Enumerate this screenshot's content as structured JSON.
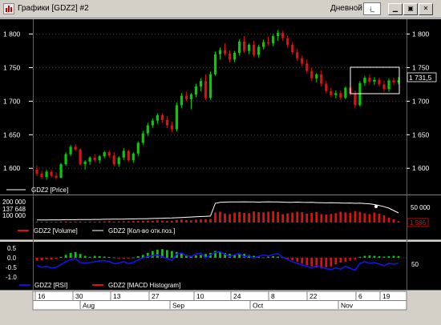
{
  "window": {
    "title": "Графики [GDZ2] #2",
    "period_label": "Дневной",
    "period_icon": "dropdown-arrow-icon",
    "buttons": [
      "minimize-icon",
      "restore-icon",
      "close-icon"
    ]
  },
  "price_pane": {
    "y_labels": [
      "1 800",
      "1 750",
      "1 700",
      "1 650",
      "1 600"
    ],
    "current_price": "1 731,5",
    "legend": [
      {
        "label": "GDZ2 [Price]",
        "color": "#ffffff"
      }
    ]
  },
  "volume_pane": {
    "left_labels": [
      "200 000",
      "137 648",
      "100 000"
    ],
    "right_labels": [
      "50 000"
    ],
    "current_value": "1 586",
    "legend": [
      {
        "label": "GDZ2 [Volume]",
        "color": "#e01010"
      },
      {
        "label": "GDZ2 [Кол-во отк.поз.]",
        "color": "#ffffff"
      }
    ]
  },
  "indicator_pane": {
    "left_labels": [
      "0.5",
      "0.0",
      "-0.5",
      "-1.0"
    ],
    "right_labels": [
      "50"
    ],
    "legend": [
      {
        "label": "GDZ2 [RSI]",
        "color": "#1010e0"
      },
      {
        "label": "GDZ2 [MACD Histogram]",
        "color": "#e01010"
      }
    ]
  },
  "date_axis": {
    "days": [
      "16",
      "30",
      "13",
      "27",
      "10",
      "24",
      "8",
      "22",
      "6",
      "19"
    ],
    "months": [
      "Aug",
      "Sep",
      "Oct",
      "Nov"
    ]
  },
  "colors": {
    "background": "#000000",
    "bull": "#00d000",
    "bear": "#e01010",
    "grid": "#404040",
    "window": "#d4d0c8",
    "highlight_box": "#ffffff"
  },
  "chart_data": [
    {
      "type": "candlestick",
      "title": "",
      "series_name": "GDZ2 [Price]",
      "ylim": [
        1580,
        1815
      ],
      "y_ticks": [
        1600,
        1650,
        1700,
        1750,
        1800
      ],
      "ohlc": [
        [
          1598,
          1604,
          1588,
          1592
        ],
        [
          1592,
          1596,
          1584,
          1587
        ],
        [
          1587,
          1598,
          1583,
          1595
        ],
        [
          1595,
          1598,
          1586,
          1589
        ],
        [
          1589,
          1594,
          1583,
          1586
        ],
        [
          1586,
          1608,
          1585,
          1606
        ],
        [
          1606,
          1624,
          1604,
          1621
        ],
        [
          1621,
          1635,
          1618,
          1632
        ],
        [
          1632,
          1636,
          1626,
          1628
        ],
        [
          1628,
          1630,
          1604,
          1606
        ],
        [
          1606,
          1612,
          1598,
          1610
        ],
        [
          1610,
          1618,
          1605,
          1616
        ],
        [
          1616,
          1621,
          1609,
          1612
        ],
        [
          1612,
          1620,
          1607,
          1618
        ],
        [
          1618,
          1626,
          1615,
          1624
        ],
        [
          1624,
          1627,
          1616,
          1619
        ],
        [
          1619,
          1624,
          1603,
          1606
        ],
        [
          1606,
          1618,
          1602,
          1616
        ],
        [
          1616,
          1630,
          1612,
          1626
        ],
        [
          1626,
          1628,
          1610,
          1612
        ],
        [
          1612,
          1624,
          1608,
          1622
        ],
        [
          1622,
          1640,
          1618,
          1638
        ],
        [
          1638,
          1656,
          1635,
          1652
        ],
        [
          1652,
          1668,
          1648,
          1664
        ],
        [
          1664,
          1674,
          1660,
          1671
        ],
        [
          1671,
          1682,
          1666,
          1679
        ],
        [
          1679,
          1682,
          1668,
          1672
        ],
        [
          1672,
          1678,
          1660,
          1664
        ],
        [
          1664,
          1670,
          1654,
          1658
        ],
        [
          1658,
          1698,
          1655,
          1694
        ],
        [
          1694,
          1712,
          1690,
          1708
        ],
        [
          1708,
          1714,
          1700,
          1703
        ],
        [
          1703,
          1712,
          1688,
          1710
        ],
        [
          1710,
          1726,
          1706,
          1722
        ],
        [
          1722,
          1734,
          1715,
          1730
        ],
        [
          1730,
          1740,
          1702,
          1705
        ],
        [
          1705,
          1744,
          1702,
          1740
        ],
        [
          1740,
          1774,
          1738,
          1770
        ],
        [
          1770,
          1780,
          1762,
          1776
        ],
        [
          1776,
          1786,
          1768,
          1771
        ],
        [
          1771,
          1776,
          1758,
          1762
        ],
        [
          1762,
          1775,
          1758,
          1772
        ],
        [
          1772,
          1792,
          1768,
          1789
        ],
        [
          1789,
          1797,
          1772,
          1775
        ],
        [
          1775,
          1786,
          1770,
          1784
        ],
        [
          1784,
          1790,
          1766,
          1769
        ],
        [
          1769,
          1784,
          1765,
          1781
        ],
        [
          1781,
          1792,
          1777,
          1788
        ],
        [
          1788,
          1796,
          1783,
          1786
        ],
        [
          1786,
          1800,
          1782,
          1797
        ],
        [
          1797,
          1806,
          1790,
          1802
        ],
        [
          1802,
          1805,
          1790,
          1794
        ],
        [
          1794,
          1798,
          1780,
          1784
        ],
        [
          1784,
          1788,
          1770,
          1773
        ],
        [
          1773,
          1778,
          1760,
          1764
        ],
        [
          1764,
          1768,
          1752,
          1756
        ],
        [
          1756,
          1762,
          1742,
          1745
        ],
        [
          1745,
          1750,
          1730,
          1734
        ],
        [
          1734,
          1742,
          1728,
          1740
        ],
        [
          1740,
          1746,
          1722,
          1726
        ],
        [
          1726,
          1730,
          1712,
          1715
        ],
        [
          1715,
          1720,
          1706,
          1709
        ],
        [
          1709,
          1716,
          1704,
          1712
        ],
        [
          1712,
          1716,
          1702,
          1705
        ],
        [
          1705,
          1722,
          1703,
          1720
        ],
        [
          1720,
          1726,
          1708,
          1711
        ],
        [
          1711,
          1716,
          1690,
          1694
        ],
        [
          1694,
          1730,
          1692,
          1727
        ],
        [
          1727,
          1738,
          1723,
          1735
        ],
        [
          1735,
          1740,
          1726,
          1729
        ],
        [
          1729,
          1736,
          1724,
          1732
        ],
        [
          1732,
          1735,
          1722,
          1725
        ],
        [
          1725,
          1731,
          1714,
          1718
        ],
        [
          1718,
          1734,
          1714,
          1731
        ],
        [
          1731,
          1735,
          1724,
          1728
        ],
        [
          1728,
          1736,
          1725,
          1731
        ]
      ]
    },
    {
      "type": "bar",
      "series": [
        {
          "name": "GDZ2 [Volume]",
          "values": [
            8,
            6,
            7,
            5,
            6,
            9,
            10,
            7,
            8,
            9,
            6,
            8,
            7,
            9,
            10,
            12,
            8,
            9,
            11,
            10,
            13,
            12,
            14,
            16,
            15,
            18,
            14,
            13,
            15,
            22,
            25,
            20,
            18,
            23,
            26,
            28,
            30,
            85,
            90,
            75,
            70,
            82,
            88,
            80,
            78,
            92,
            86,
            84,
            90,
            95,
            88,
            70,
            76,
            82,
            90,
            86,
            74,
            80,
            88,
            70,
            66,
            72,
            78,
            90,
            84,
            80,
            95,
            88,
            76,
            70,
            82,
            74,
            60,
            40,
            28,
            12
          ]
        },
        {
          "name": "GDZ2 [Кол-во отк.поз.]",
          "values": [
            22,
            22,
            22,
            23,
            23,
            23,
            24,
            24,
            24,
            25,
            25,
            25,
            26,
            26,
            27,
            27,
            28,
            28,
            29,
            30,
            30,
            31,
            32,
            33,
            34,
            35,
            36,
            37,
            38,
            40,
            42,
            44,
            46,
            48,
            50,
            52,
            54,
            160,
            168,
            170,
            172,
            171,
            172,
            173,
            172,
            172,
            170,
            171,
            173,
            172,
            171,
            170,
            169,
            168,
            170,
            168,
            167,
            168,
            166,
            165,
            164,
            165,
            164,
            163,
            162,
            163,
            160,
            162,
            158,
            156,
            150,
            142,
            132,
            120,
            100,
            80
          ]
        }
      ]
    },
    {
      "type": "bar",
      "series": [
        {
          "name": "GDZ2 [MACD Histogram]",
          "values": [
            -0.15,
            -0.12,
            -0.08,
            -0.1,
            -0.06,
            0.05,
            0.15,
            0.25,
            0.3,
            0.2,
            0.1,
            0.05,
            0.1,
            0.08,
            0.06,
            0.04,
            0.02,
            -0.02,
            -0.05,
            -0.04,
            0.02,
            0.08,
            0.15,
            0.25,
            0.35,
            0.42,
            0.45,
            0.4,
            0.35,
            0.3,
            0.22,
            0.15,
            0.1,
            0.12,
            0.15,
            0.2,
            0.25,
            0.35,
            0.3,
            0.25,
            0.2,
            0.15,
            0.18,
            0.2,
            0.15,
            0.1,
            0.05,
            0.02,
            0.05,
            0.08,
            0.06,
            0.02,
            -0.05,
            -0.12,
            -0.2,
            -0.3,
            -0.38,
            -0.45,
            -0.5,
            -0.55,
            -0.5,
            -0.45,
            -0.35,
            -0.25,
            -0.2,
            -0.15,
            -0.1,
            0.05,
            0.1,
            0.12,
            0.1,
            0.08,
            0.06,
            0.08,
            0.1,
            0.09
          ]
        },
        {
          "name": "GDZ2 [RSI]",
          "values": [
            42,
            38,
            40,
            36,
            38,
            45,
            52,
            58,
            60,
            50,
            48,
            50,
            52,
            54,
            55,
            53,
            47,
            49,
            52,
            47,
            50,
            57,
            62,
            66,
            68,
            70,
            65,
            60,
            56,
            72,
            75,
            68,
            66,
            72,
            75,
            62,
            70,
            76,
            78,
            72,
            66,
            70,
            74,
            65,
            68,
            62,
            66,
            70,
            67,
            71,
            73,
            64,
            58,
            52,
            48,
            44,
            40,
            36,
            42,
            38,
            34,
            32,
            36,
            33,
            40,
            35,
            30,
            48,
            52,
            48,
            50,
            46,
            42,
            48,
            46,
            48
          ]
        }
      ]
    }
  ]
}
